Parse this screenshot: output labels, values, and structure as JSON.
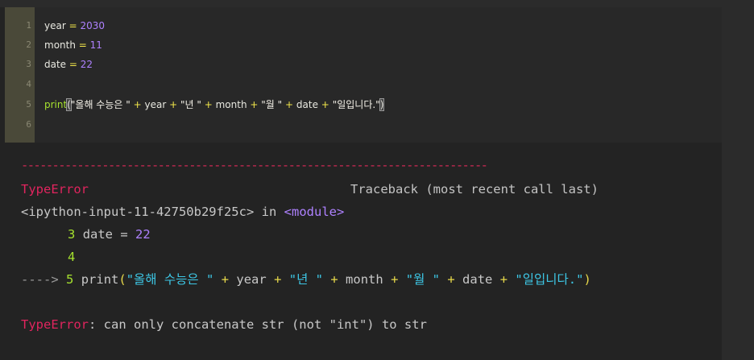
{
  "editor": {
    "line_numbers": [
      "1",
      "2",
      "3",
      "4",
      "5",
      "6"
    ],
    "line1": {
      "var": "year",
      "op": "=",
      "value": "2030"
    },
    "line2": {
      "var": "month",
      "op": "=",
      "value": "11"
    },
    "line3": {
      "var": "date",
      "op": "=",
      "value": "22"
    },
    "line5": {
      "fn": "print",
      "open": "(",
      "s1": "\"올해 수능은 \"",
      "plus": "+",
      "v1": "year",
      "s2": "\"년 \"",
      "v2": "month",
      "s3": "\"월 \"",
      "v3": "date",
      "s4": "\"일입니다.\"",
      "close": ")"
    }
  },
  "output": {
    "separator": "---------------------------------------------------------------------------",
    "error_type": "TypeError",
    "traceback_header": "Traceback (most recent call last)",
    "input_ref": "<ipython-input-11-42750b29f25c>",
    "in_word": "in",
    "module": "<module>",
    "tb_line3_no": "3",
    "tb_line3_var": "date",
    "tb_line3_op": "=",
    "tb_line3_val": "22",
    "tb_line4_no": "4",
    "tb_arrow": "---->",
    "tb_line5_no": "5",
    "tb_print": "print",
    "error_message": ": can only concatenate str (not \"int\") to str"
  },
  "colors": {
    "background": "#232323",
    "gutter": "#4a4939",
    "error_red": "#e0245e",
    "keyword_green": "#a6e22e",
    "number_purple": "#ae81ff",
    "string_blue": "#3dc7e6"
  }
}
